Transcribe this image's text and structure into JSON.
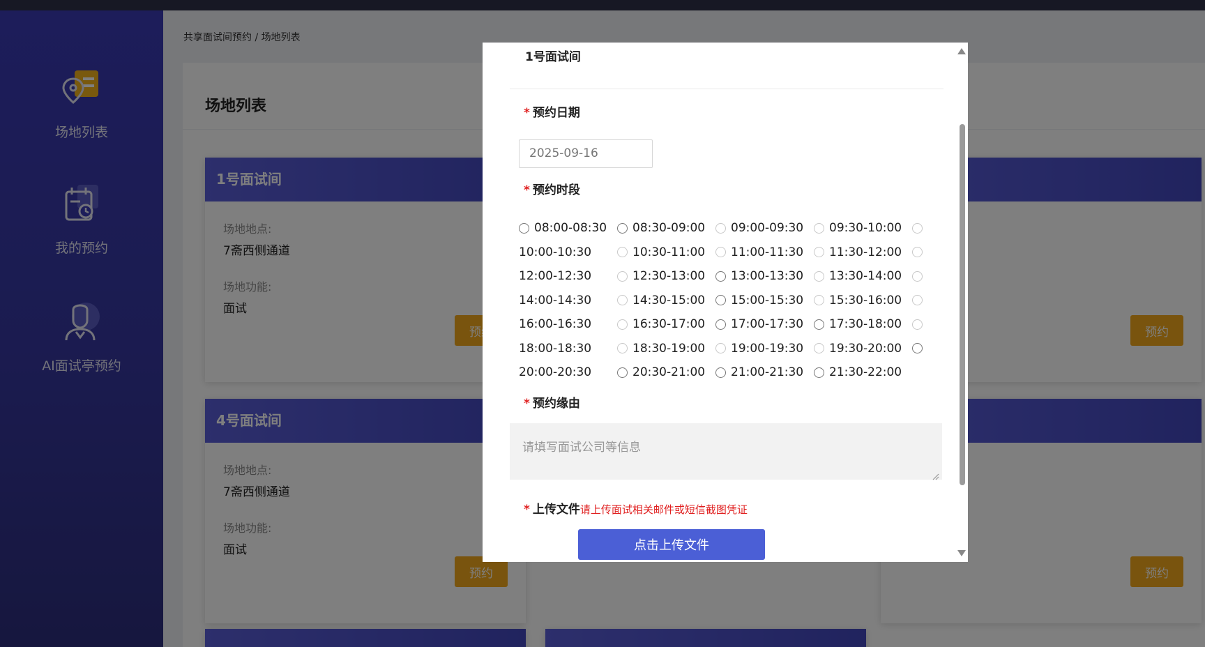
{
  "breadcrumb": "共享面试间预约 / 场地列表",
  "sidebar": {
    "items": [
      {
        "label": "场地列表",
        "icon": "location-card-icon"
      },
      {
        "label": "我的预约",
        "icon": "calendar-clock-icon"
      },
      {
        "label": "AI面试亭预约",
        "icon": "person-avatar-icon"
      }
    ]
  },
  "panel": {
    "title": "场地列表"
  },
  "cards": [
    {
      "name": "1号面试间",
      "location_label": "场地地点:",
      "location": "7斋西侧通道",
      "function_label": "场地功能:",
      "function": "面试",
      "button": "预约"
    },
    {
      "name": "",
      "location_label": "",
      "location": "",
      "function_label": "",
      "function": "",
      "button": "预约"
    },
    {
      "name": "4号面试间",
      "location_label": "场地地点:",
      "location": "7斋西侧通道",
      "function_label": "场地功能:",
      "function": "面试",
      "button": "预约"
    },
    {
      "name": "",
      "location_label": "",
      "location": "",
      "function_label": "",
      "function": "",
      "button": "预约"
    }
  ],
  "modal": {
    "room_name": "1号面试间",
    "date_label": "预约日期",
    "date_value": "2025-09-16",
    "slot_label": "预约时段",
    "slots": [
      [
        "08:00-08:30",
        "08:30-09:00",
        "09:00-09:30",
        "09:30-10:00"
      ],
      [
        "10:00-10:30",
        "10:30-11:00",
        "11:00-11:30",
        "11:30-12:00"
      ],
      [
        "12:00-12:30",
        "12:30-13:00",
        "13:00-13:30",
        "13:30-14:00"
      ],
      [
        "14:00-14:30",
        "14:30-15:00",
        "15:00-15:30",
        "15:30-16:00"
      ],
      [
        "16:00-16:30",
        "16:30-17:00",
        "17:00-17:30",
        "17:30-18:00"
      ],
      [
        "18:00-18:30",
        "18:30-19:00",
        "19:00-19:30",
        "19:30-20:00"
      ],
      [
        "20:00-20:30",
        "20:30-21:00",
        "21:00-21:30",
        "21:30-22:00"
      ]
    ],
    "reason_label": "预约缘由",
    "reason_placeholder": "请填写面试公司等信息",
    "upload_label": "上传文件",
    "upload_hint": "请上传面试相关邮件或短信截图凭证",
    "upload_button": "点击上传文件"
  },
  "colors": {
    "sidebar": "#3a3ab5",
    "card_header": "#4a4fc8",
    "reserve_button": "#f2a91c",
    "upload_button": "#4b5fd6",
    "required": "#e02020"
  }
}
